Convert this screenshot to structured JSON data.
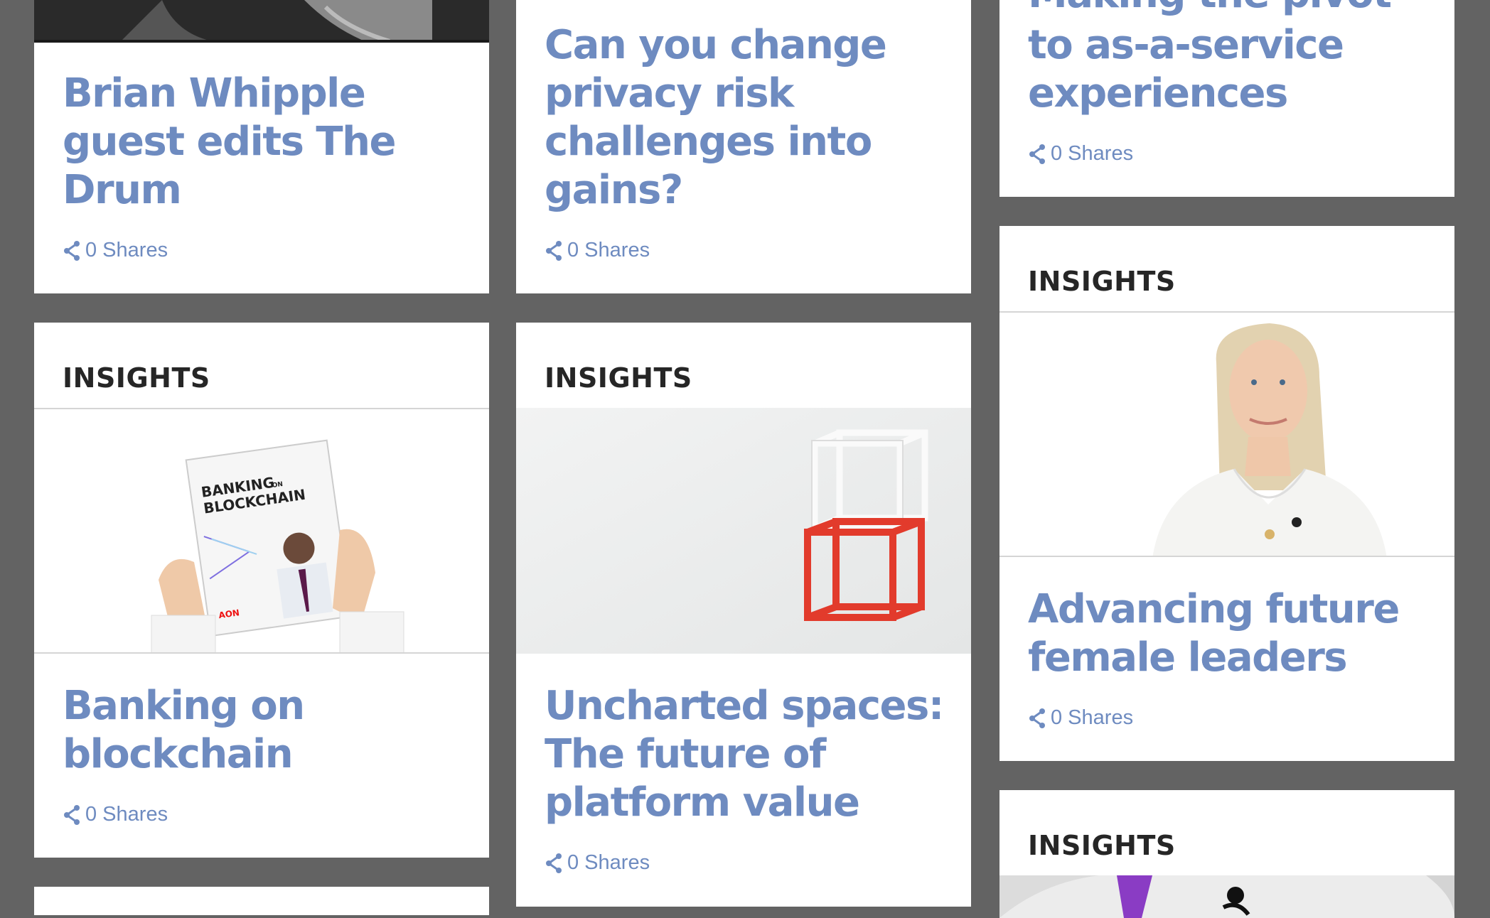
{
  "cards": {
    "brian": {
      "title": "Brian Whipple guest edits The Drum",
      "shares": "0 Shares",
      "share_icon": "share-icon"
    },
    "privacy": {
      "title": "Can you change privacy risk challenges into gains?",
      "shares": "0 Shares"
    },
    "pivot": {
      "title_top": "Making the pivot",
      "title": "to as-a-service experiences",
      "shares": "0 Shares"
    },
    "blockchain": {
      "category": "INSIGHTS",
      "title": "Banking on blockchain",
      "shares": "0 Shares",
      "image_text": {
        "line1": "BANKING",
        "on": "ON",
        "line2": "BLOCKCHAIN",
        "brand": "AON"
      }
    },
    "uncharted": {
      "category": "INSIGHTS",
      "title": "Uncharted spaces: The future of platform value",
      "shares": "0 Shares"
    },
    "female": {
      "category": "INSIGHTS",
      "title": "Advancing future female leaders",
      "shares": "0 Shares"
    },
    "bottom_right": {
      "category": "INSIGHTS"
    }
  },
  "colors": {
    "background": "#636363",
    "card": "#ffffff",
    "title": "#6e8bc0",
    "category": "#262626"
  }
}
